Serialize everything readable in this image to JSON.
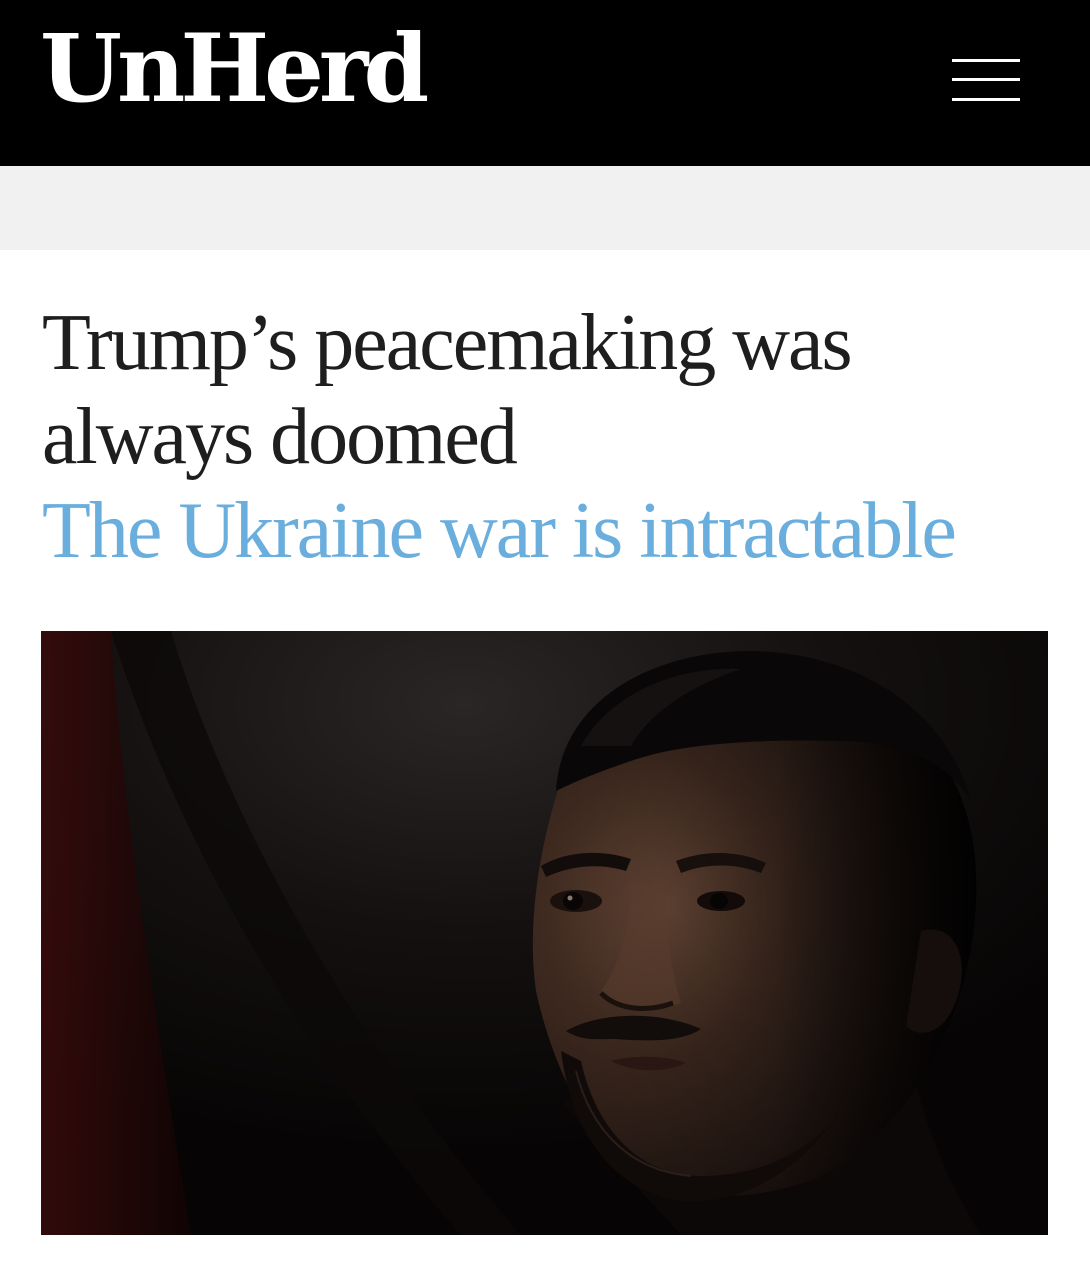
{
  "header": {
    "logo_text": "UnHerd",
    "menu_icon": "hamburger-menu-icon",
    "background_color": "#000000"
  },
  "article": {
    "title": "Trump’s peacemaking was always doomed",
    "subtitle": "The Ukraine war is intractable",
    "title_color": "#1e1e1e",
    "subtitle_color": "#6aaedd"
  },
  "hero_image": {
    "alt": "Dimly lit portrait of a man with dark hair and a beard"
  }
}
